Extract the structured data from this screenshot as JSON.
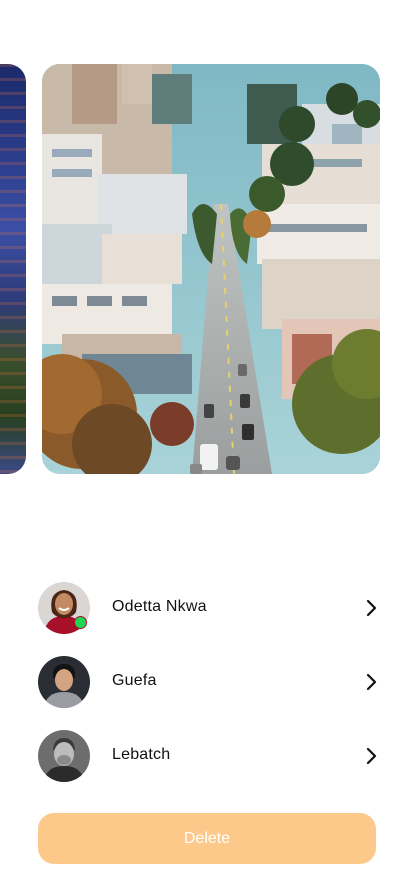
{
  "carousel": {
    "cards": [
      {
        "name": "city-tower-photo"
      },
      {
        "name": "city-street-photo"
      }
    ]
  },
  "contacts": [
    {
      "name": "Odetta Nkwa",
      "online": true,
      "icon": "chevron-right-icon"
    },
    {
      "name": "Guefa",
      "online": false,
      "icon": "chevron-right-icon"
    },
    {
      "name": "Lebatch",
      "online": false,
      "icon": "chevron-right-icon"
    }
  ],
  "actions": {
    "delete_label": "Delete"
  },
  "colors": {
    "accent": "#fdc98a",
    "online": "#1fd655",
    "text": "#111111"
  }
}
